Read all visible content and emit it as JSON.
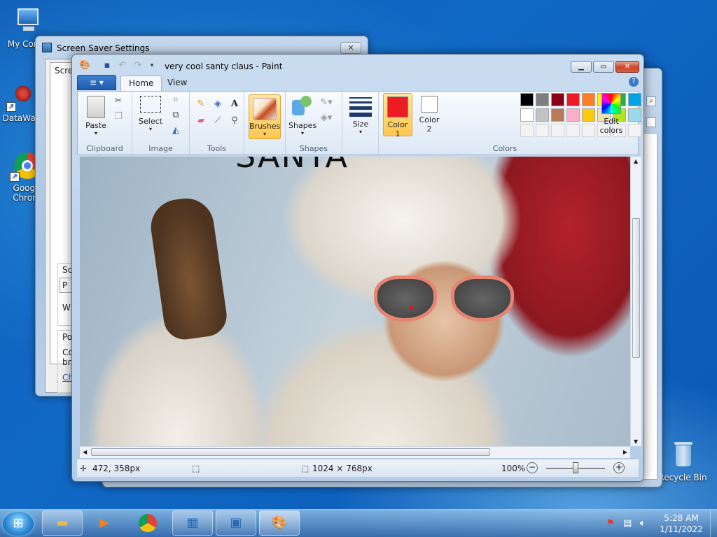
{
  "desktop": {
    "icons": [
      {
        "label": "My Comp"
      },
      {
        "label": "DataWag"
      },
      {
        "label": "Googl Chron"
      },
      {
        "label": "Recycle Bin"
      }
    ]
  },
  "screensaver": {
    "title": "Screen Saver Settings",
    "tab_label": "Screen",
    "sections": [
      "Sc",
      "P",
      "W",
      "Po",
      "Co",
      "br",
      "Ch"
    ]
  },
  "paint": {
    "title": "very cool santy claus - Paint",
    "menu_file": "≡",
    "tabs": [
      "Home",
      "View"
    ],
    "groups": {
      "clipboard": {
        "label": "Clipboard",
        "paste": "Paste"
      },
      "image": {
        "label": "Image",
        "select": "Select"
      },
      "tools": {
        "label": "Tools"
      },
      "brushes": {
        "label": "Brushes"
      },
      "shapes": {
        "label": "Shapes",
        "shapes_btn": "Shapes"
      },
      "size": {
        "label": "Size"
      },
      "colors": {
        "label": "Colors",
        "color1": "Color",
        "color1_num": "1",
        "color2": "Color",
        "color2_num": "2",
        "edit": "Edit",
        "edit2": "colors",
        "color1_value": "#ed1c24",
        "color2_value": "#ffffff",
        "palette_row1": [
          "#000000",
          "#7f7f7f",
          "#880015",
          "#ed1c24",
          "#ff7f27",
          "#fff200",
          "#22b14c",
          "#00a2e8",
          "#3f48cc",
          "#a349a4"
        ],
        "palette_row2": [
          "#ffffff",
          "#c3c3c3",
          "#b97a57",
          "#ffaec9",
          "#ffc90e",
          "#efe4b0",
          "#b5e61d",
          "#99d9ea",
          "#7092be",
          "#c8bfe7"
        ],
        "palette_row3": [
          "",
          "",
          "",
          "",
          "",
          "",
          "",
          "",
          "",
          ""
        ]
      }
    },
    "canvas_text": "SANTA",
    "status": {
      "cursor_pos": "472, 358px",
      "selection": "",
      "image_size": "1024 × 768px",
      "zoom": "100%"
    }
  },
  "taskbar": {
    "time": "5:28 AM",
    "date": "1/11/2022"
  }
}
